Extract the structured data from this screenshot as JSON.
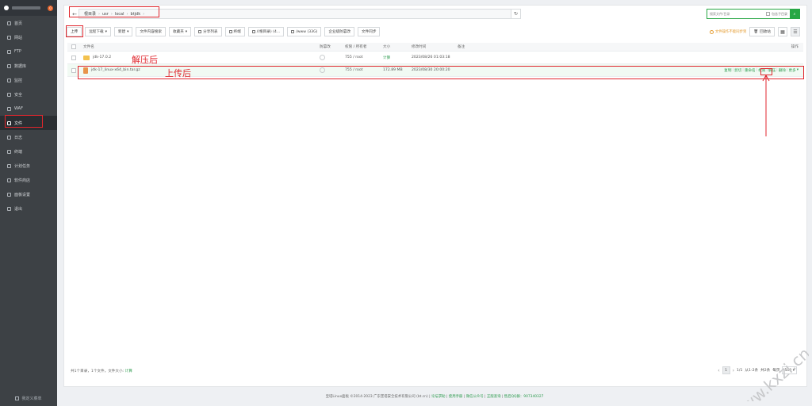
{
  "sidebar": {
    "badge": "0",
    "items": [
      {
        "label": "首页",
        "icon": "home-icon"
      },
      {
        "label": "网站",
        "icon": "globe-icon"
      },
      {
        "label": "FTP",
        "icon": "ftp-icon"
      },
      {
        "label": "数据库",
        "icon": "database-icon"
      },
      {
        "label": "监控",
        "icon": "monitor-icon"
      },
      {
        "label": "安全",
        "icon": "shield-icon"
      },
      {
        "label": "WAF",
        "icon": "waf-icon"
      },
      {
        "label": "文件",
        "icon": "folder-icon",
        "active": true
      },
      {
        "label": "日志",
        "icon": "log-icon"
      },
      {
        "label": "终端",
        "icon": "terminal-icon"
      },
      {
        "label": "计划任务",
        "icon": "clock-icon"
      },
      {
        "label": "软件商店",
        "icon": "store-icon"
      },
      {
        "label": "面板设置",
        "icon": "gear-icon"
      },
      {
        "label": "退出",
        "icon": "logout-icon"
      }
    ],
    "footer_label": "我定义菜单"
  },
  "path": {
    "crumbs": [
      "根目录",
      "usr",
      "local",
      "btjdk"
    ],
    "refresh_icon": "refresh-icon"
  },
  "search": {
    "placeholder": "搜索文件/目录",
    "include_subdir": "包含子目录"
  },
  "toolbar": {
    "buttons": [
      "上传",
      "远程下载",
      "新建",
      "文件内容搜索",
      "收藏夹",
      "分享列表",
      "终端",
      "/(根目录) (4...",
      "/www (33G)",
      "企业级防篡改",
      "文件同步"
    ]
  },
  "right_tools": {
    "warning": "文件操作不能同步到",
    "recycle": "回收站"
  },
  "table": {
    "headers": {
      "name": "文件名",
      "protect": "防篡改",
      "perm": "权限 / 所有者",
      "size": "大小",
      "mtime": "修改时间",
      "note": "备注",
      "ops": "操作"
    },
    "rows": [
      {
        "name": "jdk-17.0.2",
        "type": "folder",
        "perm": "755 / root",
        "size": "计算",
        "mtime": "2023/08/26 01:03:18",
        "note": ""
      },
      {
        "name": "jdk-17_linux-x64_bin.tar.gz",
        "type": "archive",
        "perm": "755 / root",
        "size": "172.89 MB",
        "mtime": "2023/08/30 20:00:20",
        "note": "",
        "ops": [
          "复制",
          "剪切",
          "重命名",
          "权限",
          "解压",
          "删除",
          "更多"
        ]
      }
    ]
  },
  "annotations": {
    "after_extract": "解压后",
    "after_upload": "上传后"
  },
  "status": {
    "text": "共1个目录，1个文件，文件大小:",
    "link": "计算"
  },
  "pager": {
    "current": "1",
    "range": "1/1",
    "from": "从1-2条",
    "total": "共2条",
    "per_page_label": "每页",
    "per_page_value": "500"
  },
  "footer": {
    "copyright": "宝塔Linux面板 ©2014-2023 广东堡塔安全技术有限公司 (bt.cn)",
    "links": [
      "论坛求助",
      "使用手册",
      "微信公众号",
      "正版查询"
    ],
    "qq": "售后QQ群：907340327"
  },
  "watermark": "www.kxzi.cn"
}
